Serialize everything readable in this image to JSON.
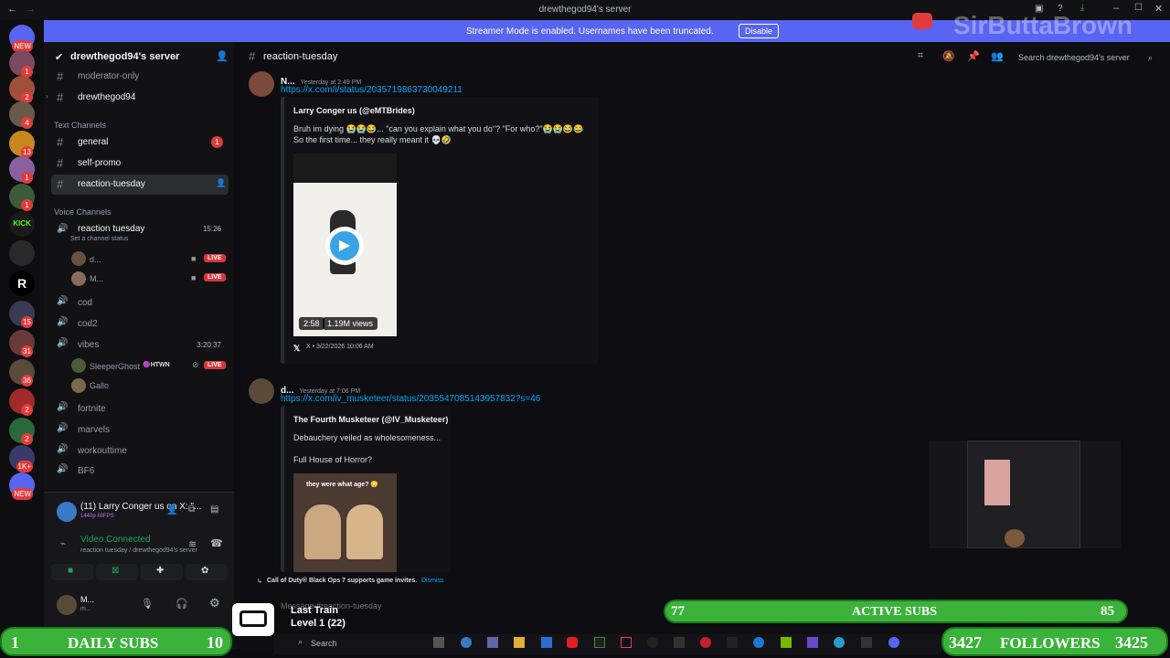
{
  "window": {
    "title": "drewthegod94's server"
  },
  "banner": {
    "message": "Streamer Mode is enabled. Usernames have been truncated.",
    "action": "Disable"
  },
  "watermark": "SirButtaBrown",
  "server_badges": [
    "NEW",
    "1",
    "2",
    "4",
    "13",
    "1",
    "1",
    "15",
    "31",
    "36",
    "2",
    "2",
    "1K+",
    "NEW"
  ],
  "sidebar": {
    "server_name": "drewthegod94's server",
    "top_channels": [
      "moderator-only",
      "drewthegod94"
    ],
    "text_category": "Text Channels",
    "text_channels": [
      {
        "name": "general",
        "badge": "1"
      },
      {
        "name": "self-promo"
      },
      {
        "name": "reaction-tuesday"
      }
    ],
    "voice_category": "Voice Channels",
    "voice_main": {
      "name": "reaction tuesday",
      "time": "15:26",
      "status": "Set a channel status"
    },
    "voice_users": [
      {
        "name": "d..."
      },
      {
        "name": "M..."
      }
    ],
    "voice_channels": [
      "cod",
      "cod2",
      "vibes",
      "fortnite",
      "marvels",
      "workouttime",
      "BF6"
    ],
    "vibes_time": "3:20:37",
    "vibes_users": [
      {
        "name": "SleeperGhost",
        "tag": "HTWN"
      },
      {
        "name": "Gallo"
      }
    ],
    "live_label": "LIVE",
    "stream": {
      "title": "(11) Larry Conger us on X: \"...",
      "quality": "1440p 60FPS"
    },
    "connection": {
      "status": "Video Connected",
      "detail": "reaction tuesday / drewthegod94's server"
    },
    "user": {
      "name": "M...",
      "sub": "m..."
    }
  },
  "main": {
    "channel": "reaction-tuesday",
    "search_placeholder": "Search drewthegod94's server",
    "messages": [
      {
        "author": "N...",
        "time": "Yesterday at 2:49 PM",
        "link": "https://x.com/i/status/2035719863730049211",
        "embed_author": "Larry Conger us (@eMTBrides)",
        "embed_line1": "Bruh im dying 😭😭😂... \"can you explain what you do\"? \"For who?\"😭😭😂😂",
        "embed_line2": "So the first time... they really meant it 💀🤣",
        "duration": "2:58",
        "views": "1.19M views",
        "footer": "X • 3/22/2026 10:06 AM"
      },
      {
        "author": "d...",
        "time": "Yesterday at 7:06 PM",
        "link": "https://x.com/iv_musketeer/status/2035547085143957832?s=46",
        "embed_author": "The Fourth Musketeer (@IV_Musketeer)",
        "embed_line1": "Debauchery veiled as wholesomeness...",
        "embed_line2": "Full House of Horror?",
        "thumb_caption": "they were what age? 😳"
      }
    ],
    "invite_notice": "Call of Duty® Black Ops 7 supports game invites.",
    "invite_dismiss": "Dismiss",
    "composer_placeholder": "Message #reaction-tuesday"
  },
  "overlay": {
    "train_title": "Last Train",
    "train_level": "Level 1  (22)",
    "active_subs_count": "77",
    "active_subs_label": "ACTIVE SUBS",
    "active_subs_right": "85",
    "daily_left": "1",
    "daily_label": "DAILY SUBS",
    "daily_right": "10",
    "followers_left": "3427",
    "followers_label": "FOLLOWERS",
    "followers_right": "3425",
    "taskbar_search": "Search"
  }
}
